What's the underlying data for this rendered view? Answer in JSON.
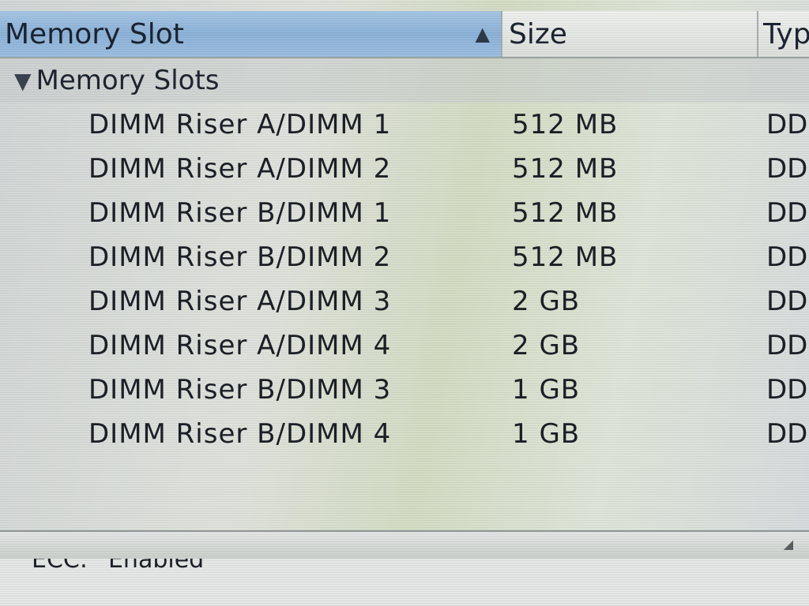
{
  "table": {
    "columns": {
      "slot": "Memory Slot",
      "size": "Size",
      "type": "Typ"
    },
    "sort_indicator": "▲",
    "group": {
      "disclosure": "▼",
      "label": "Memory Slots"
    },
    "rows": [
      {
        "slot": "DIMM Riser A/DIMM 1",
        "size": "512 MB",
        "type": "DD"
      },
      {
        "slot": "DIMM Riser A/DIMM 2",
        "size": "512 MB",
        "type": "DD"
      },
      {
        "slot": "DIMM Riser B/DIMM 1",
        "size": "512 MB",
        "type": "DD"
      },
      {
        "slot": "DIMM Riser B/DIMM 2",
        "size": "512 MB",
        "type": "DD"
      },
      {
        "slot": "DIMM Riser A/DIMM 3",
        "size": "2 GB",
        "type": "DD"
      },
      {
        "slot": "DIMM Riser A/DIMM 4",
        "size": "2 GB",
        "type": "DD"
      },
      {
        "slot": "DIMM Riser B/DIMM 3",
        "size": "1 GB",
        "type": "DD"
      },
      {
        "slot": "DIMM Riser B/DIMM 4",
        "size": "1 GB",
        "type": "DD"
      }
    ]
  },
  "detail": {
    "ecc_label": "ECC:",
    "ecc_value": "Enabled"
  },
  "icons": {
    "sort": "sort-ascending-icon",
    "disclosure": "disclosure-triangle-icon",
    "split_handle": "resize-handle-icon"
  },
  "colors": {
    "selected_header": "#9dbfe0",
    "text": "#1b1f26"
  }
}
